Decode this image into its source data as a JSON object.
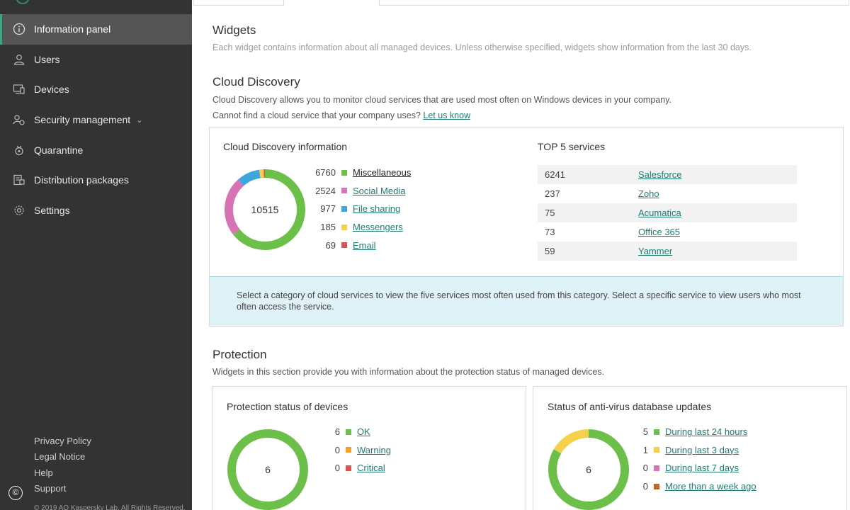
{
  "sidebar": {
    "items": [
      {
        "label": "Information panel",
        "icon": "info-icon",
        "active": true
      },
      {
        "label": "Users",
        "icon": "user-icon"
      },
      {
        "label": "Devices",
        "icon": "devices-icon"
      },
      {
        "label": "Security management",
        "icon": "security-icon",
        "has_submenu": true
      },
      {
        "label": "Quarantine",
        "icon": "quarantine-icon"
      },
      {
        "label": "Distribution packages",
        "icon": "package-icon"
      },
      {
        "label": "Settings",
        "icon": "gear-icon"
      }
    ],
    "footer_links": [
      "Privacy Policy",
      "Legal Notice",
      "Help",
      "Support"
    ],
    "copyright_symbol": "©",
    "copyright_text": "© 2019 AO Kaspersky Lab. All Rights Reserved."
  },
  "widgets": {
    "title": "Widgets",
    "description": "Each widget contains information about all managed devices. Unless otherwise specified, widgets show information from the last 30 days."
  },
  "cloud_discovery": {
    "title": "Cloud Discovery",
    "description": "Cloud Discovery allows you to monitor cloud services that are used most often on Windows devices in your company.",
    "prompt_text": "Cannot find a cloud service that your company uses?",
    "prompt_link": "Let us know",
    "info_card": {
      "title": "Cloud Discovery information",
      "total": "10515",
      "categories": [
        {
          "count": "6760",
          "label": "Miscellaneous",
          "color": "#6cc04a",
          "selected": true
        },
        {
          "count": "2524",
          "label": "Social Media",
          "color": "#d873b8"
        },
        {
          "count": "977",
          "label": "File sharing",
          "color": "#3ea6dc"
        },
        {
          "count": "185",
          "label": "Messengers",
          "color": "#f5d04a"
        },
        {
          "count": "69",
          "label": "Email",
          "color": "#d9534f"
        }
      ]
    },
    "top5": {
      "title": "TOP 5 services",
      "rows": [
        {
          "count": "6241",
          "service": "Salesforce"
        },
        {
          "count": "237",
          "service": "Zoho"
        },
        {
          "count": "75",
          "service": "Acumatica"
        },
        {
          "count": "73",
          "service": "Office 365"
        },
        {
          "count": "59",
          "service": "Yammer"
        }
      ]
    },
    "hint": "Select a category of cloud services to view the five services most often used from this category. Select a specific service to view users who most often access the service."
  },
  "protection": {
    "title": "Protection",
    "description": "Widgets in this section provide you with information about the protection status of managed devices.",
    "status_card": {
      "title": "Protection status of devices",
      "total": "6",
      "items": [
        {
          "count": "6",
          "label": "OK",
          "color": "#6cc04a"
        },
        {
          "count": "0",
          "label": "Warning",
          "color": "#f0a030"
        },
        {
          "count": "0",
          "label": "Critical",
          "color": "#d9534f"
        }
      ]
    },
    "updates_card": {
      "title": "Status of anti-virus database updates",
      "total": "6",
      "items": [
        {
          "count": "5",
          "label": "During last 24 hours",
          "color": "#6cc04a"
        },
        {
          "count": "1",
          "label": "During last 3 days",
          "color": "#f5d04a"
        },
        {
          "count": "0",
          "label": "During last 7 days",
          "color": "#d873b8"
        },
        {
          "count": "0",
          "label": "More than a week ago",
          "color": "#c9622a"
        }
      ]
    }
  }
}
